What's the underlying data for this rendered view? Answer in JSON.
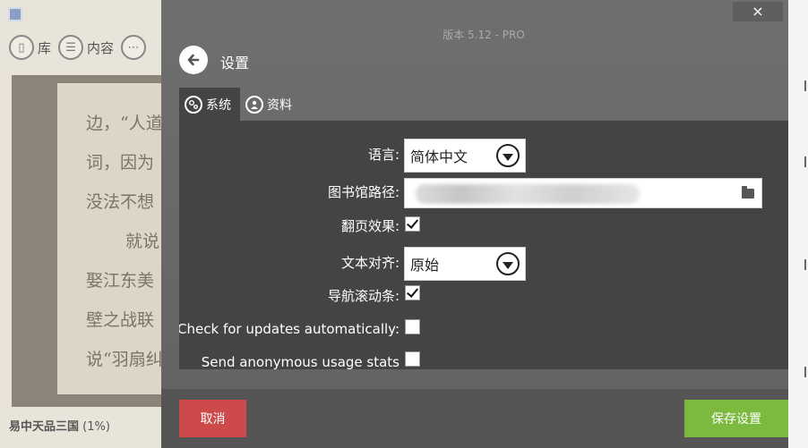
{
  "reader": {
    "toolbar": [
      {
        "label": "库",
        "icon": "book-icon",
        "glyph": "▯"
      },
      {
        "label": "内容",
        "icon": "list-icon",
        "glyph": "☰"
      },
      {
        "label": "",
        "icon": "comment-icon",
        "glyph": "⋯"
      }
    ],
    "book_lines": [
      "边，“人道",
      "词，因为",
      "没法不想",
      "就说",
      "娶江东美",
      "壁之战联",
      "说“羽扇纠"
    ],
    "book_title": "易中天品三国",
    "book_progress": "(1%)"
  },
  "dialog": {
    "close_glyph": "×",
    "version": "版本 5.12 - PRO",
    "title": "设置",
    "tabs": [
      {
        "label": "系统",
        "icon": "gears-icon",
        "active": true
      },
      {
        "label": "资料",
        "icon": "user-icon",
        "active": false
      }
    ],
    "settings": {
      "language_label": "语言:",
      "language_value": "简体中文",
      "library_path_label": "图书馆路径:",
      "page_turn_label": "翻页效果:",
      "page_turn_checked": true,
      "text_align_label": "文本对齐:",
      "text_align_value": "原始",
      "nav_scrollbar_label": "导航滚动条:",
      "nav_scrollbar_checked": true,
      "auto_update_label": "Check for updates automatically:",
      "auto_update_checked": false,
      "usage_stats_label": "Send anonymous usage stats",
      "usage_stats_checked": false
    },
    "cancel_label": "取消",
    "save_label": "保存设置"
  },
  "colors": {
    "dialog_bg": "#646464",
    "panel_bg": "#444444",
    "cancel": "#cd4a4a",
    "save": "#7cba3f"
  }
}
